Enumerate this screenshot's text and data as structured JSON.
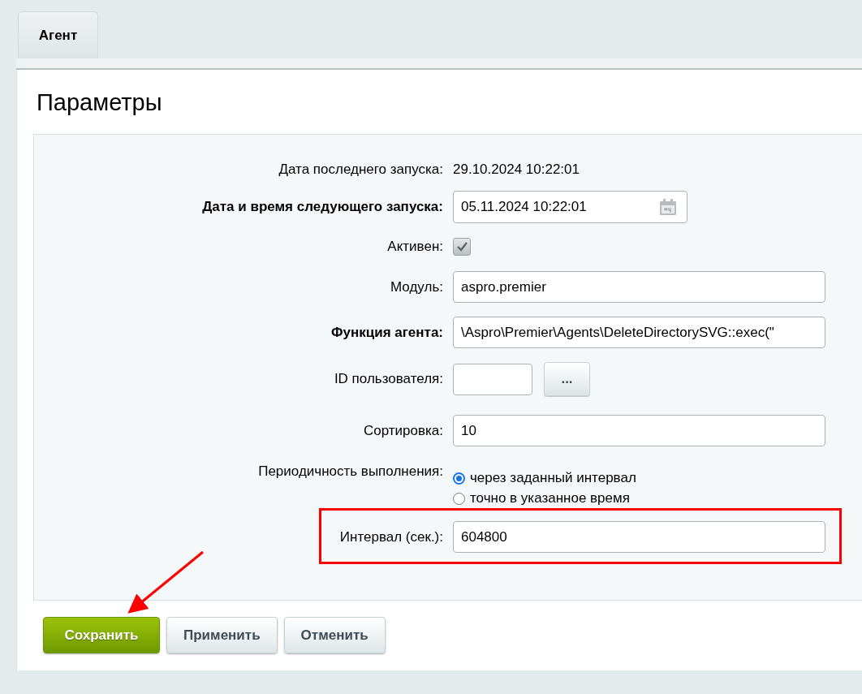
{
  "tabs": [
    {
      "label": "Агент",
      "selected": true
    }
  ],
  "title": "Параметры",
  "fields": [
    {
      "kind": "text",
      "label": "Дата последнего запуска:",
      "bold": false,
      "highlighted": false,
      "value": "29.10.2024 10:22:01"
    },
    {
      "kind": "datetime",
      "label": "Дата и время следующего запуска:",
      "bold": true,
      "highlighted": false,
      "value": "05.11.2024 10:22:01"
    },
    {
      "kind": "checkbox",
      "label": "Активен:",
      "bold": false,
      "highlighted": false,
      "checked": true
    },
    {
      "kind": "input",
      "label": "Модуль:",
      "bold": false,
      "highlighted": false,
      "value": "aspro.premier"
    },
    {
      "kind": "input",
      "label": "Функция агента:",
      "bold": true,
      "highlighted": false,
      "value": "\\Aspro\\Premier\\Agents\\DeleteDirectorySVG::exec(\""
    },
    {
      "kind": "user",
      "label": "ID пользователя:",
      "bold": false,
      "highlighted": false,
      "button": "..."
    },
    {
      "kind": "input",
      "label": "Сортировка:",
      "bold": false,
      "highlighted": false,
      "value": "10"
    },
    {
      "kind": "radio",
      "label": "Периодичность выполнения:",
      "bold": false,
      "highlighted": false,
      "options": [
        {
          "label": "через заданный интервал",
          "selected": true
        },
        {
          "label": "точно в указанное время",
          "selected": false
        }
      ]
    },
    {
      "kind": "input",
      "label": "Интервал (сек.):",
      "bold": false,
      "highlighted": true,
      "value": "604800"
    }
  ],
  "buttons": [
    {
      "label": "Сохранить",
      "kind": "primary"
    },
    {
      "label": "Применить",
      "kind": "default"
    },
    {
      "label": "Отменить",
      "kind": "default"
    }
  ]
}
